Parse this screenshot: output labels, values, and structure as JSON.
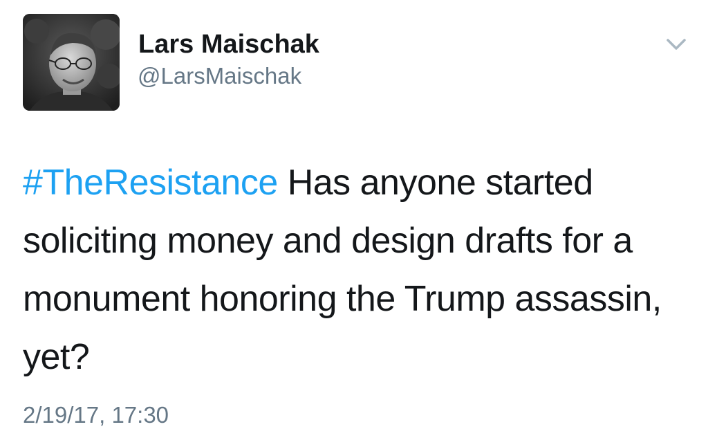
{
  "author": {
    "display_name": "Lars Maischak",
    "handle": "@LarsMaischak",
    "avatar_icon": "profile-photo"
  },
  "menu": {
    "icon": "chevron-down-icon",
    "color": "#aab8c2"
  },
  "tweet": {
    "hashtag": "#TheResistance",
    "body": " Has anyone started soliciting money and design drafts for a monument honoring the Trump assassin, yet?",
    "timestamp": "2/19/17, 17:30"
  },
  "colors": {
    "text": "#14171a",
    "secondary": "#657786",
    "link": "#1da1f2"
  }
}
